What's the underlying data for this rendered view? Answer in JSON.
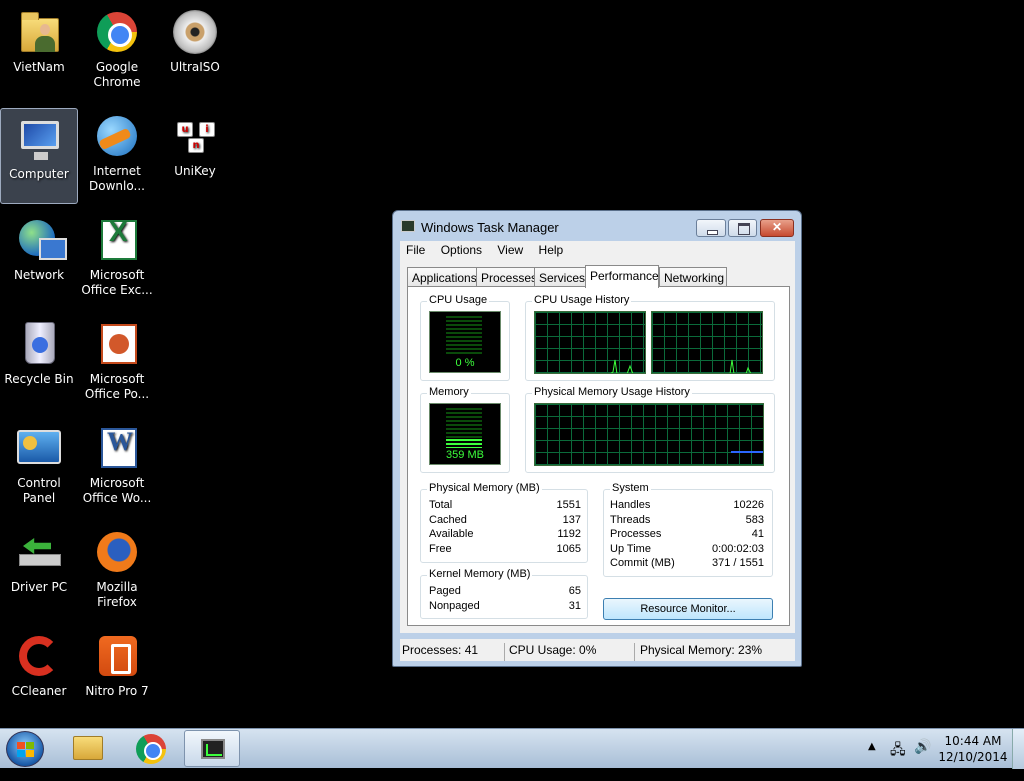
{
  "desktop": {
    "icons": [
      {
        "label": "VietNam"
      },
      {
        "label": "Google Chrome"
      },
      {
        "label": "UltraISO"
      },
      {
        "label": "Computer"
      },
      {
        "label": "Internet Downlo..."
      },
      {
        "label": "UniKey"
      },
      {
        "label": "Network"
      },
      {
        "label": "Microsoft Office Exc..."
      },
      {
        "label": "Recycle Bin"
      },
      {
        "label": "Microsoft Office Po..."
      },
      {
        "label": "Control Panel"
      },
      {
        "label": "Microsoft Office Wo..."
      },
      {
        "label": "Driver PC"
      },
      {
        "label": "Mozilla Firefox"
      },
      {
        "label": "CCleaner"
      },
      {
        "label": "Nitro Pro 7"
      }
    ],
    "unikey_letters": [
      "u",
      "i",
      "n"
    ]
  },
  "taskmanager": {
    "title": "Windows Task Manager",
    "menu": [
      "File",
      "Options",
      "View",
      "Help"
    ],
    "tabs": [
      "Applications",
      "Processes",
      "Services",
      "Performance",
      "Networking"
    ],
    "active_tab": "Performance",
    "cpu_usage": {
      "label": "CPU Usage",
      "value": "0 %",
      "percent": 0
    },
    "cpu_history": {
      "label": "CPU Usage History"
    },
    "memory": {
      "label": "Memory",
      "value": "359 MB",
      "percent": 23
    },
    "memory_history": {
      "label": "Physical Memory Usage History"
    },
    "physical_memory": {
      "label": "Physical Memory (MB)",
      "rows": [
        {
          "k": "Total",
          "v": "1551"
        },
        {
          "k": "Cached",
          "v": "137"
        },
        {
          "k": "Available",
          "v": "1192"
        },
        {
          "k": "Free",
          "v": "1065"
        }
      ]
    },
    "kernel_memory": {
      "label": "Kernel Memory (MB)",
      "rows": [
        {
          "k": "Paged",
          "v": "65"
        },
        {
          "k": "Nonpaged",
          "v": "31"
        }
      ]
    },
    "system": {
      "label": "System",
      "rows": [
        {
          "k": "Handles",
          "v": "10226"
        },
        {
          "k": "Threads",
          "v": "583"
        },
        {
          "k": "Processes",
          "v": "41"
        },
        {
          "k": "Up Time",
          "v": "0:00:02:03"
        },
        {
          "k": "Commit (MB)",
          "v": "371 / 1551"
        }
      ]
    },
    "resource_monitor_button": "Resource Monitor...",
    "status": {
      "processes": "Processes: 41",
      "cpu": "CPU Usage: 0%",
      "memory": "Physical Memory: 23%"
    }
  },
  "taskbar": {
    "clock_time": "10:44 AM",
    "clock_date": "12/10/2014"
  },
  "colors": {
    "desktop_bg": "#000000",
    "graph_line": "#3cff3c",
    "grid": "#0b6a3a",
    "memory_line": "#2b66ff"
  }
}
